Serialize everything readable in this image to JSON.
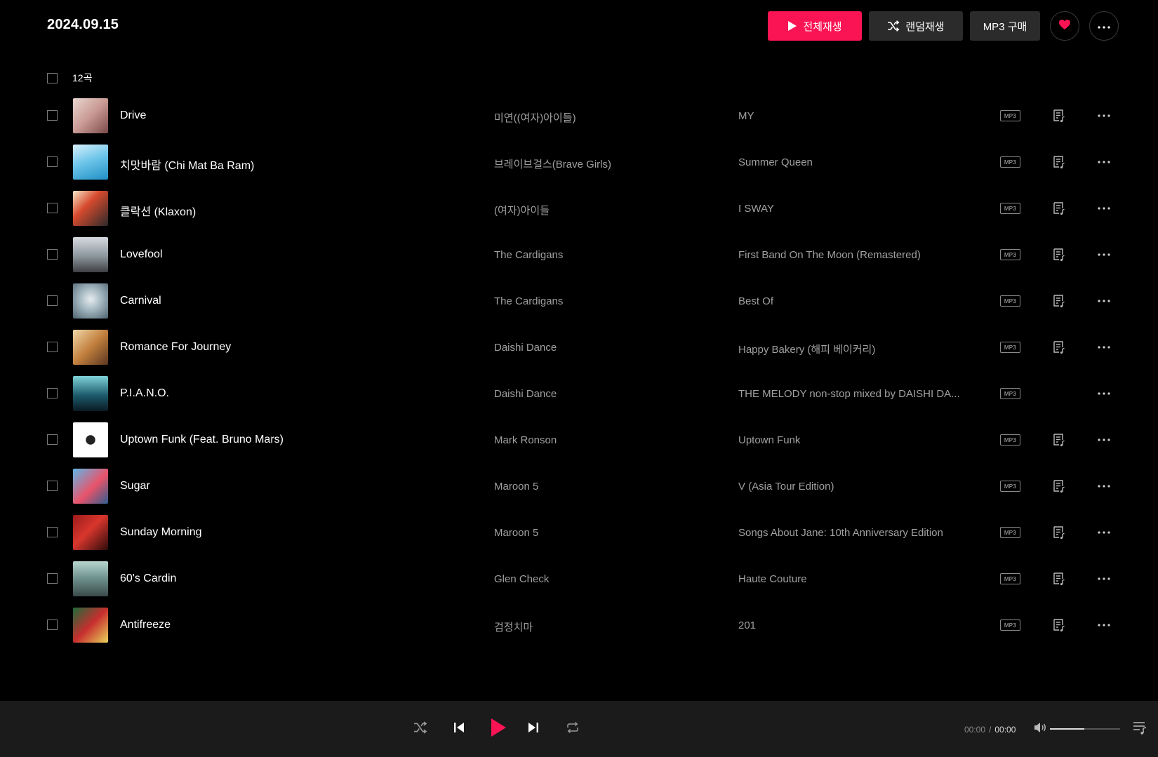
{
  "header": {
    "date": "2024.09.15",
    "play_all_label": "전체재생",
    "random_play_label": "랜덤재생",
    "mp3_buy_label": "MP3 구매"
  },
  "list": {
    "count_label": "12곡",
    "mp3_badge": "MP3",
    "tracks": [
      {
        "title": "Drive",
        "artist": "미연((여자)아이들)",
        "album": "MY",
        "playlist_add": true
      },
      {
        "title": "치맛바람 (Chi Mat Ba Ram)",
        "artist": "브레이브걸스(Brave Girls)",
        "album": "Summer Queen",
        "playlist_add": true
      },
      {
        "title": "클락션 (Klaxon)",
        "artist": "(여자)아이들",
        "album": "I SWAY",
        "playlist_add": true
      },
      {
        "title": "Lovefool",
        "artist": "The Cardigans",
        "album": "First Band On The Moon (Remastered)",
        "playlist_add": true
      },
      {
        "title": "Carnival",
        "artist": "The Cardigans",
        "album": "Best Of",
        "playlist_add": true
      },
      {
        "title": "Romance For Journey",
        "artist": "Daishi Dance",
        "album": "Happy Bakery (해피 베이커리)",
        "playlist_add": true
      },
      {
        "title": "P.I.A.N.O.",
        "artist": "Daishi Dance",
        "album": "THE MELODY non-stop mixed by DAISHI DA...",
        "playlist_add": false
      },
      {
        "title": "Uptown Funk (Feat. Bruno Mars)",
        "artist": "Mark Ronson",
        "album": "Uptown Funk",
        "playlist_add": true
      },
      {
        "title": "Sugar",
        "artist": "Maroon 5",
        "album": "V (Asia Tour Edition)",
        "playlist_add": true
      },
      {
        "title": "Sunday Morning",
        "artist": "Maroon 5",
        "album": "Songs About Jane: 10th Anniversary Edition",
        "playlist_add": true
      },
      {
        "title": "60's Cardin",
        "artist": "Glen Check",
        "album": "Haute Couture",
        "playlist_add": true
      },
      {
        "title": "Antifreeze",
        "artist": "검정치마",
        "album": "201",
        "playlist_add": true
      }
    ]
  },
  "player": {
    "current_time": "00:00",
    "separator": "/",
    "total_time": "00:00",
    "volume_level": 0.49
  },
  "colors": {
    "accent": "#fa1454",
    "background": "#000000",
    "player_bar": "#1b1b1b",
    "secondary_text": "#a0a0a0"
  },
  "icons": {
    "play_all": "play-icon",
    "random": "shuffle-icon",
    "like": "heart-icon",
    "more": "more-horizontal-icon",
    "track_playlist_add": "playlist-add-icon",
    "player_shuffle": "shuffle-icon",
    "player_prev": "skip-previous-icon",
    "player_play": "play-icon",
    "player_next": "skip-next-icon",
    "player_repeat": "repeat-icon",
    "player_volume": "volume-icon",
    "player_queue": "queue-list-icon"
  }
}
